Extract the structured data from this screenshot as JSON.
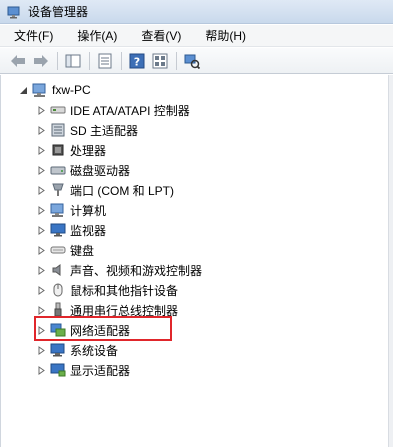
{
  "window": {
    "title": "设备管理器"
  },
  "menu": {
    "file": "文件(F)",
    "action": "操作(A)",
    "view": "查看(V)",
    "help": "帮助(H)"
  },
  "tree": {
    "root": "fxw-PC",
    "nodes": [
      {
        "label": "IDE ATA/ATAPI 控制器",
        "icon": "ide-controller-icon"
      },
      {
        "label": "SD 主适配器",
        "icon": "sd-host-icon"
      },
      {
        "label": "处理器",
        "icon": "processor-icon"
      },
      {
        "label": "磁盘驱动器",
        "icon": "disk-drive-icon"
      },
      {
        "label": "端口 (COM 和 LPT)",
        "icon": "port-icon"
      },
      {
        "label": "计算机",
        "icon": "computer-icon"
      },
      {
        "label": "监视器",
        "icon": "monitor-icon"
      },
      {
        "label": "键盘",
        "icon": "keyboard-icon"
      },
      {
        "label": "声音、视频和游戏控制器",
        "icon": "speaker-icon"
      },
      {
        "label": "鼠标和其他指针设备",
        "icon": "mouse-icon"
      },
      {
        "label": "通用串行总线控制器",
        "icon": "usb-icon"
      },
      {
        "label": "网络适配器",
        "icon": "network-adapter-icon"
      },
      {
        "label": "系统设备",
        "icon": "system-devices-icon"
      },
      {
        "label": "显示适配器",
        "icon": "display-adapter-icon"
      }
    ]
  },
  "highlight": {
    "color": "#e0262b",
    "target": "网络适配器"
  }
}
